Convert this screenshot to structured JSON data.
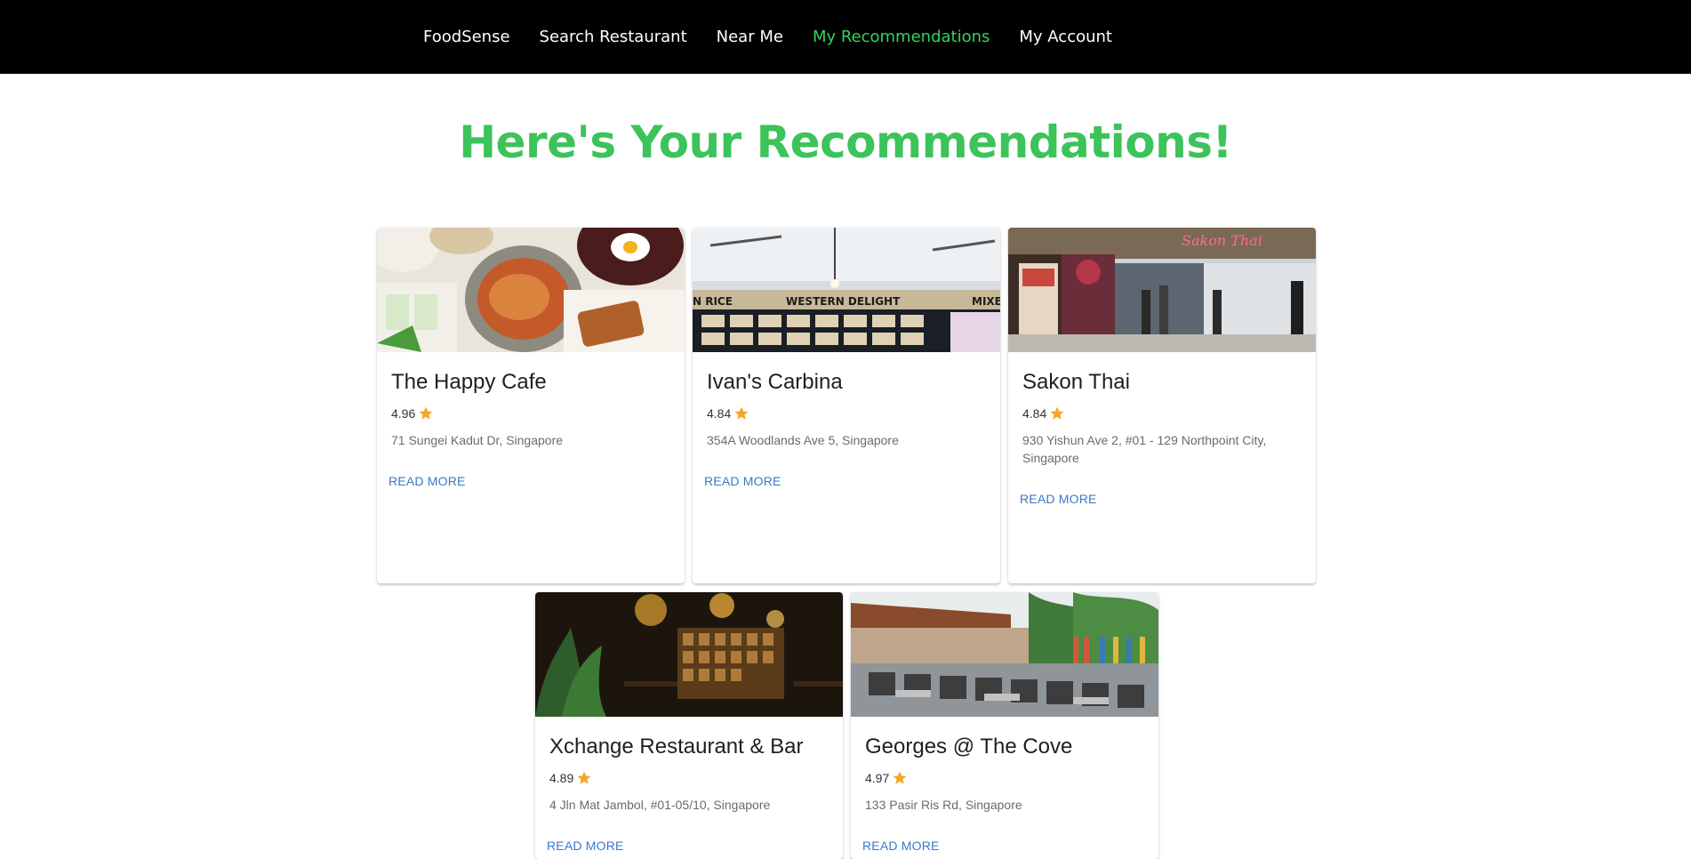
{
  "nav": {
    "items": [
      {
        "label": "FoodSense",
        "active": false
      },
      {
        "label": "Search Restaurant",
        "active": false
      },
      {
        "label": "Near Me",
        "active": false
      },
      {
        "label": "My Recommendations",
        "active": true
      },
      {
        "label": "My Account",
        "active": false
      }
    ]
  },
  "main": {
    "title": "Here's Your Recommendations!",
    "restaurants": [
      {
        "name": "The Happy Cafe",
        "rating": "4.96",
        "address": "71 Sungei Kadut Dr, Singapore",
        "link": "READ MORE"
      },
      {
        "name": "Ivan's Carbina",
        "rating": "4.84",
        "address": "354A Woodlands Ave 5, Singapore",
        "link": "READ MORE"
      },
      {
        "name": "Sakon Thai",
        "rating": "4.84",
        "address": "930 Yishun Ave 2, #01 - 129 Northpoint City, Singapore",
        "link": "READ MORE"
      },
      {
        "name": "Xchange Restaurant & Bar",
        "rating": "4.89",
        "address": "4 Jln Mat Jambol, #01-05/10, Singapore",
        "link": "READ MORE"
      },
      {
        "name": "Georges @ The Cove",
        "rating": "4.97",
        "address": "133 Pasir Ris Rd, Singapore",
        "link": "READ MORE"
      }
    ]
  },
  "colors": {
    "nav_background": "#000000",
    "nav_active": "#2fd45c",
    "title": "#3cc35a",
    "link": "#3a78c6",
    "star": "#f5a623"
  },
  "icons": {
    "rating": "star-icon"
  }
}
